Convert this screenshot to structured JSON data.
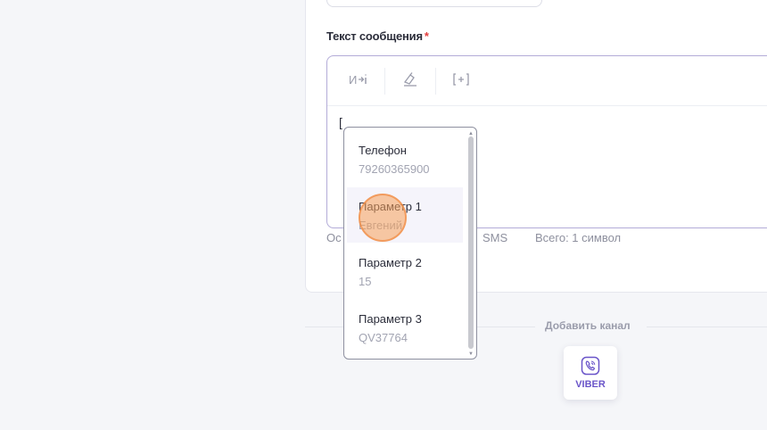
{
  "form": {
    "message_label": "Текст сообщения",
    "required_mark": "*",
    "toolbar": {
      "variable_label": "И›İ",
      "clear_label": "🧹",
      "insert_label": "[+]"
    },
    "editor_text": "[",
    "counter_left": "Ос",
    "counter_sms": "SMS",
    "counter_total": "Всего: 1 символ"
  },
  "dropdown": {
    "items": [
      {
        "name": "Телефон",
        "value": "79260365900"
      },
      {
        "name": "Параметр 1",
        "value": "Евгений"
      },
      {
        "name": "Параметр 2",
        "value": "15"
      },
      {
        "name": "Параметр 3",
        "value": "QV37764"
      }
    ]
  },
  "channels": {
    "add_label": "Добавить канал",
    "viber_label": "VIBER",
    "viber_icon": "viber-phone-icon"
  },
  "colors": {
    "accent": "#6a55c9",
    "required": "#e23c3c",
    "click_marker": "#f5a05a"
  }
}
